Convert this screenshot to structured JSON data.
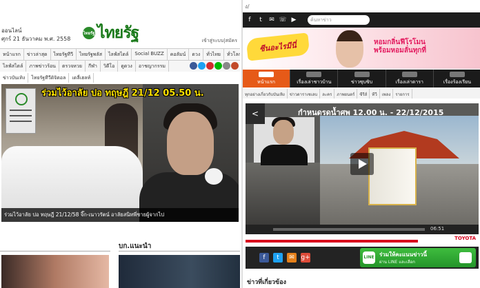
{
  "left": {
    "site_sub": "ออนไลน์",
    "date": "ศุกร์ 21 ธันวาคม พ.ศ. 2558",
    "logo_text": "ไทยรัฐ",
    "logo_badge": "ไทยรัฐ",
    "login": "เข้าสู่ระบบ|สมัคร",
    "nav1": [
      "หน้าแรก",
      "ข่าวล่าสุด",
      "ไทยรัฐทีวี",
      "ไทยรัฐพลัส",
      "ไลฟ์สไตล์",
      "Social BUZZ",
      "คอลัมน์",
      "ดวง",
      "ทั่วไทย",
      "ทั่วโลก"
    ],
    "nav2": [
      "ไลฟ์สไตล์",
      "ภาพข่าวร้อน",
      "ตรวจหวย",
      "กีฬา",
      "วิดีโอ",
      "ดูดวง",
      "อาชญากรรม"
    ],
    "nav3": [
      "ข่าวบันเทิง",
      "ไทยรัฐทีวีดิจิตอล",
      "เดลี่เฮลท์"
    ],
    "social_colors": [
      "#3b5998",
      "#1da1f2",
      "#d22d2d",
      "#00b900",
      "#888888",
      "#c24a29"
    ],
    "hero_title": "ร่วมไว้อาลัย ปอ ทฤษฎี 21/12 05.50 น.",
    "hero_caption": "ร่วมไว้อาลัย ปอ ทฤษฎี 21/12/58 จิ๊ก-เนาวรัตน์ อาลัยสนิทพี่ชายผู้จากไป",
    "section1": "",
    "section2": "บก.แนะนำ"
  },
  "right": {
    "url": "ง/",
    "search_placeholder": "ค้นหาข่าว",
    "toolbar_icons": [
      "f",
      "t",
      "✉",
      "☏",
      "▶"
    ],
    "banner_logo": "ซีนอะไรมีนี่",
    "promo_line1": "หอมกลิ่นฟีโรโมน",
    "promo_line2": "พร้อมหอมลั่นทุกที่",
    "menu": [
      "หน้าแรก",
      "เรื่องเล่าชาวบ้าน",
      "ข่าวซุบซิบ",
      "เรื่องเล่าดารา",
      "เรื่องร้องเรียน"
    ],
    "submenu": [
      "ทุกอย่างเกี่ยวกับบันเทิง",
      "ข่าวดาราเซเลบ",
      "ละคร",
      "ภาพยนตร์",
      "ซีรีส์",
      "ทีวี",
      "เพลง",
      "รายการ"
    ],
    "video_title": "กำหนดรดน้ำศพ 12.00 น. - 22/12/2015",
    "video_time": "06:51",
    "ad_brand": "TOYOTA",
    "share_icons": [
      "f",
      "t",
      "✉",
      "g+"
    ],
    "share_colors": [
      "#3b5998",
      "#1da1f2",
      "#e5801a",
      "#dd4b39"
    ],
    "line_title": "ร่วมให้คะแนนข่าวนี้",
    "line_sub": "ผ่าน LINE และเลือก",
    "line_logo": "LINE",
    "bottom_heading": "ข่าวที่เกี่ยวข้อง"
  }
}
